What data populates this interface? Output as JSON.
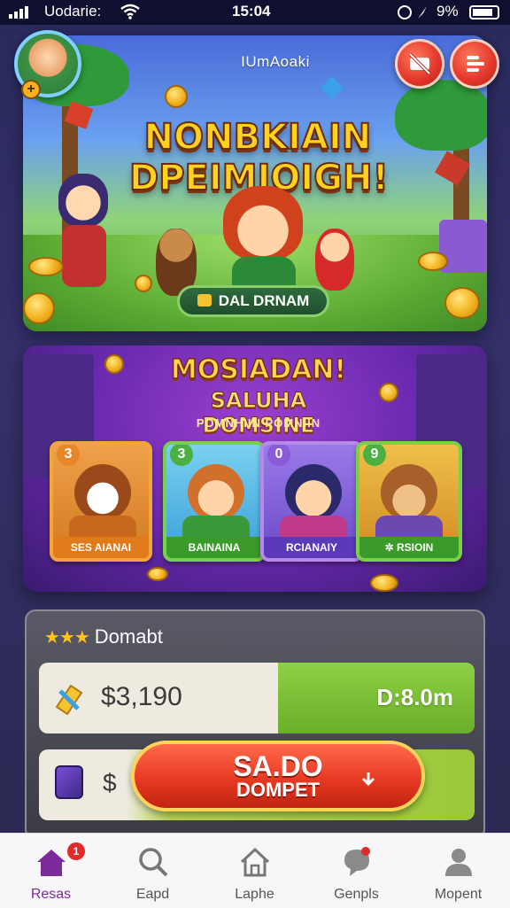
{
  "status_bar": {
    "carrier": "Uodarie:",
    "time": "15:04",
    "battery": "9%"
  },
  "banner": {
    "small_title": "IUmAoaki",
    "title_line1": "NONBKIAIN",
    "title_line2": "DPEIMIOIGH!",
    "cta_label": "DAL DRNAM"
  },
  "promo": {
    "title_line1": "MOSIADAN!",
    "title_line2": "SALUHA DOMSINE",
    "title_line3": "POMNHIIN POMNIIN",
    "cards": [
      {
        "num": "3",
        "label": "SES AIANAI"
      },
      {
        "num": "3",
        "label": "BAINAINA"
      },
      {
        "num": "0",
        "label": "RCIANAIY"
      },
      {
        "num": "9",
        "label": "✲ RSIOIN"
      }
    ]
  },
  "wallet": {
    "title": "Domabt",
    "amount": "$3,190",
    "duration": "D:8.0m",
    "row2_dollar": "$",
    "button_line1": "SA.DO",
    "button_line2": "DOMPET"
  },
  "tabs": [
    {
      "label": "Resas",
      "badge": "1"
    },
    {
      "label": "Eapd"
    },
    {
      "label": "Laphe"
    },
    {
      "label": "Genpls"
    },
    {
      "label": "Mopent"
    }
  ],
  "colors": {
    "accent_purple": "#7a2a9a",
    "cta_red": "#e83a22",
    "green": "#8ed044",
    "gold": "#ffd21e"
  }
}
